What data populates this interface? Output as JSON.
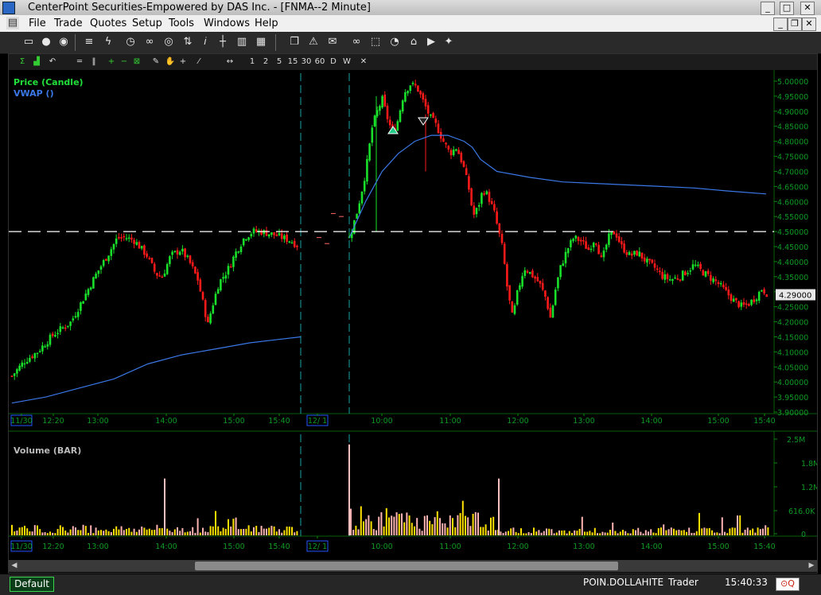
{
  "window": {
    "title": "CenterPoint Securities-Empowered by DAS Inc. - [FNMA--2 Minute]"
  },
  "menu": [
    "File",
    "Trade",
    "Quotes",
    "Setup",
    "Tools",
    "Windows",
    "Help"
  ],
  "chart_toolbar": {
    "intervals": [
      "1",
      "2",
      "5",
      "15",
      "30",
      "60",
      "D",
      "W"
    ]
  },
  "price_pane": {
    "title": "Price (Candle)",
    "overlay": "VWAP ()",
    "current_price_tag": "4.29000"
  },
  "volume_pane": {
    "title": "Volume (BAR)"
  },
  "status": {
    "layout": "Default",
    "account": "POIN.DOLLAHITE",
    "role": "Trader",
    "clock": "15:40:33"
  },
  "chart_data": [
    {
      "type": "candlestick",
      "title": "Price (Candle)",
      "overlay_series": [
        {
          "name": "VWAP ()",
          "color": "#3b78e7"
        }
      ],
      "y_ticks": [
        "5.00000",
        "4.95000",
        "4.90000",
        "4.85000",
        "4.80000",
        "4.75000",
        "4.70000",
        "4.65000",
        "4.60000",
        "4.55000",
        "4.50000",
        "4.45000",
        "4.40000",
        "4.35000",
        "4.30000",
        "4.25000",
        "4.20000",
        "4.15000",
        "4.10000",
        "4.05000",
        "4.00000",
        "3.95000",
        "3.90000"
      ],
      "ylim": [
        3.9,
        5.0
      ],
      "x_tick_labels": [
        "11/30",
        "12:20",
        "13:00",
        "14:00",
        "15:00",
        "15:40",
        "12/ 1",
        "10:00",
        "11:00",
        "12:00",
        "13:00",
        "14:00",
        "15:00",
        "15:40"
      ],
      "horizontal_line": 4.5,
      "last_price": 4.29,
      "day1_close": [
        [
          0,
          4.02
        ],
        [
          15,
          4.07
        ],
        [
          30,
          4.1
        ],
        [
          50,
          4.16
        ],
        [
          70,
          4.2
        ],
        [
          85,
          4.28
        ],
        [
          100,
          4.36
        ],
        [
          115,
          4.43
        ],
        [
          125,
          4.48
        ],
        [
          135,
          4.48
        ],
        [
          145,
          4.47
        ],
        [
          160,
          4.42
        ],
        [
          170,
          4.36
        ],
        [
          178,
          4.35
        ],
        [
          188,
          4.42
        ],
        [
          200,
          4.44
        ],
        [
          210,
          4.4
        ],
        [
          220,
          4.34
        ],
        [
          228,
          4.24
        ],
        [
          232,
          4.19
        ],
        [
          236,
          4.24
        ],
        [
          245,
          4.33
        ],
        [
          255,
          4.37
        ],
        [
          265,
          4.43
        ],
        [
          275,
          4.48
        ],
        [
          285,
          4.5
        ],
        [
          295,
          4.5
        ],
        [
          310,
          4.49
        ],
        [
          320,
          4.48
        ],
        [
          330,
          4.47
        ],
        [
          340,
          4.45
        ]
      ],
      "day1_vwap": [
        [
          0,
          3.93
        ],
        [
          40,
          3.95
        ],
        [
          80,
          3.98
        ],
        [
          120,
          4.01
        ],
        [
          160,
          4.06
        ],
        [
          200,
          4.09
        ],
        [
          240,
          4.11
        ],
        [
          280,
          4.13
        ],
        [
          310,
          4.14
        ],
        [
          340,
          4.15
        ]
      ],
      "day2_close": [
        [
          0,
          4.48
        ],
        [
          8,
          4.55
        ],
        [
          14,
          4.62
        ],
        [
          20,
          4.7
        ],
        [
          28,
          4.85
        ],
        [
          34,
          4.9
        ],
        [
          40,
          4.94
        ],
        [
          46,
          4.88
        ],
        [
          52,
          4.83
        ],
        [
          58,
          4.86
        ],
        [
          66,
          4.96
        ],
        [
          74,
          4.99
        ],
        [
          82,
          4.98
        ],
        [
          90,
          4.93
        ],
        [
          98,
          4.88
        ],
        [
          106,
          4.85
        ],
        [
          114,
          4.8
        ],
        [
          122,
          4.76
        ],
        [
          130,
          4.78
        ],
        [
          138,
          4.72
        ],
        [
          146,
          4.63
        ],
        [
          150,
          4.55
        ],
        [
          156,
          4.58
        ],
        [
          162,
          4.64
        ],
        [
          168,
          4.62
        ],
        [
          176,
          4.56
        ],
        [
          186,
          4.44
        ],
        [
          192,
          4.3
        ],
        [
          198,
          4.21
        ],
        [
          204,
          4.3
        ],
        [
          212,
          4.38
        ],
        [
          220,
          4.36
        ],
        [
          230,
          4.33
        ],
        [
          238,
          4.28
        ],
        [
          244,
          4.21
        ],
        [
          250,
          4.31
        ],
        [
          256,
          4.38
        ],
        [
          264,
          4.44
        ],
        [
          272,
          4.48
        ],
        [
          280,
          4.47
        ],
        [
          290,
          4.44
        ],
        [
          298,
          4.48
        ],
        [
          306,
          4.4
        ],
        [
          314,
          4.48
        ],
        [
          322,
          4.5
        ],
        [
          330,
          4.45
        ],
        [
          340,
          4.42
        ],
        [
          350,
          4.43
        ],
        [
          360,
          4.4
        ],
        [
          370,
          4.38
        ],
        [
          380,
          4.35
        ],
        [
          390,
          4.34
        ],
        [
          400,
          4.35
        ],
        [
          410,
          4.37
        ],
        [
          418,
          4.39
        ],
        [
          426,
          4.37
        ],
        [
          436,
          4.35
        ],
        [
          446,
          4.33
        ],
        [
          456,
          4.3
        ],
        [
          466,
          4.27
        ],
        [
          476,
          4.25
        ],
        [
          484,
          4.26
        ],
        [
          492,
          4.28
        ],
        [
          500,
          4.31
        ],
        [
          508,
          4.29
        ]
      ],
      "day2_vwap": [
        [
          0,
          4.48
        ],
        [
          20,
          4.6
        ],
        [
          40,
          4.7
        ],
        [
          60,
          4.76
        ],
        [
          80,
          4.8
        ],
        [
          100,
          4.82
        ],
        [
          120,
          4.82
        ],
        [
          140,
          4.8
        ],
        [
          150,
          4.78
        ],
        [
          160,
          4.74
        ],
        [
          180,
          4.7
        ],
        [
          220,
          4.68
        ],
        [
          260,
          4.665
        ],
        [
          300,
          4.66
        ],
        [
          340,
          4.655
        ],
        [
          380,
          4.65
        ],
        [
          420,
          4.645
        ],
        [
          460,
          4.635
        ],
        [
          508,
          4.625
        ]
      ]
    },
    {
      "type": "bar",
      "title": "Volume (BAR)",
      "y_ticks": [
        "2.5M",
        "1.8M",
        "1.2M",
        "616.0K",
        "0"
      ],
      "ylim": [
        0,
        2500000
      ],
      "notable_bars": [
        {
          "x": "13:55",
          "value": 1500000
        },
        {
          "x": "09:30",
          "value": 2400000
        },
        {
          "x": "11:45",
          "value": 1500000
        }
      ]
    }
  ]
}
